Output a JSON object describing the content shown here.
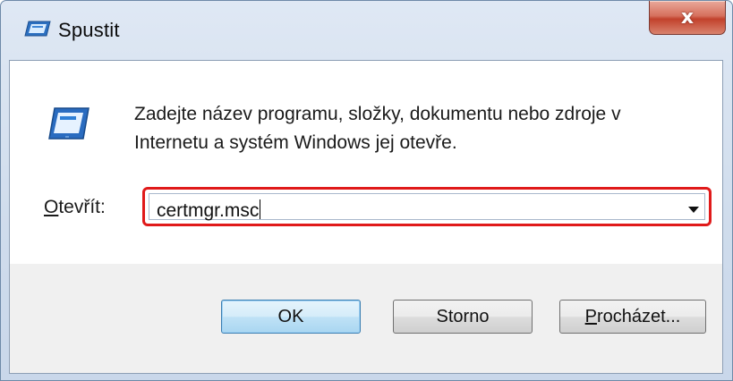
{
  "window": {
    "title": "Spustit",
    "close_label": "x"
  },
  "dialog": {
    "description_line1": "Zadejte název programu, složky, dokumentu nebo zdroje v",
    "description_line2": "Internetu a systém Windows jej otevře.",
    "open_label_accel": "O",
    "open_label_rest": "tevřít:",
    "open_value": "certmgr.msc"
  },
  "buttons": {
    "ok": "OK",
    "cancel": "Storno",
    "browse_accel": "P",
    "browse_rest": "rocházet..."
  },
  "colors": {
    "highlight": "#e01a1a"
  }
}
